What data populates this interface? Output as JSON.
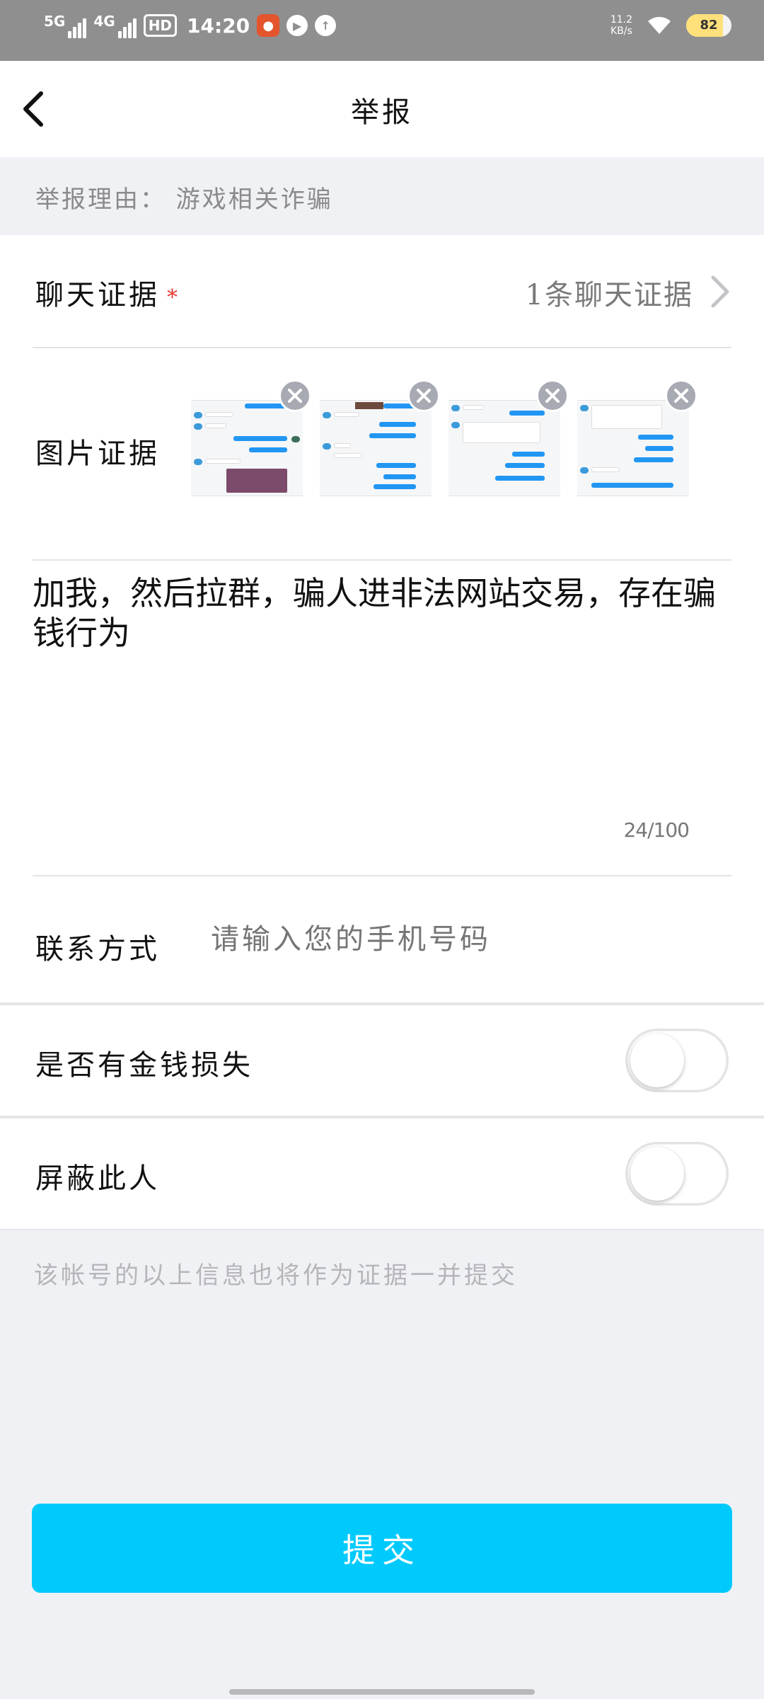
{
  "status_bar": {
    "signal1": "5G",
    "signal2": "4G",
    "hd_badge": "HD",
    "time": "14:20",
    "network_speed_value": "11.2",
    "network_speed_unit": "KB/s",
    "battery_level": "82",
    "battery_fraction": 0.82
  },
  "header": {
    "title": "举报",
    "back_icon": "chevron-left-icon"
  },
  "report_reason": {
    "text": "举报理由：  游戏相关诈骗"
  },
  "chat_evidence": {
    "label": "聊天证据",
    "required_mark": "*",
    "value": "1条聊天证据",
    "icon": "chevron-right-icon"
  },
  "image_evidence": {
    "label": "图片证据",
    "images": [
      {
        "name": "screenshot-1",
        "remove_icon": "close-icon"
      },
      {
        "name": "screenshot-2",
        "remove_icon": "close-icon"
      },
      {
        "name": "screenshot-3",
        "remove_icon": "close-icon"
      },
      {
        "name": "screenshot-4",
        "remove_icon": "close-icon"
      }
    ]
  },
  "description": {
    "value": "加我，然后拉群，骗人进非法网站交易，存在骗钱行为",
    "counter": "24/100"
  },
  "contact": {
    "label": "联系方式",
    "placeholder": "请输入您的手机号码",
    "value": ""
  },
  "money_loss": {
    "label": "是否有金钱损失",
    "enabled": false
  },
  "block_user": {
    "label": "屏蔽此人",
    "enabled": false
  },
  "note": "该帐号的以上信息也将作为证据一并提交",
  "submit": {
    "label": "提交"
  },
  "colors": {
    "accent": "#00cafc",
    "required": "#e53935",
    "status_bar": "#8f8f8f",
    "page_bg": "#f0f1f5"
  }
}
